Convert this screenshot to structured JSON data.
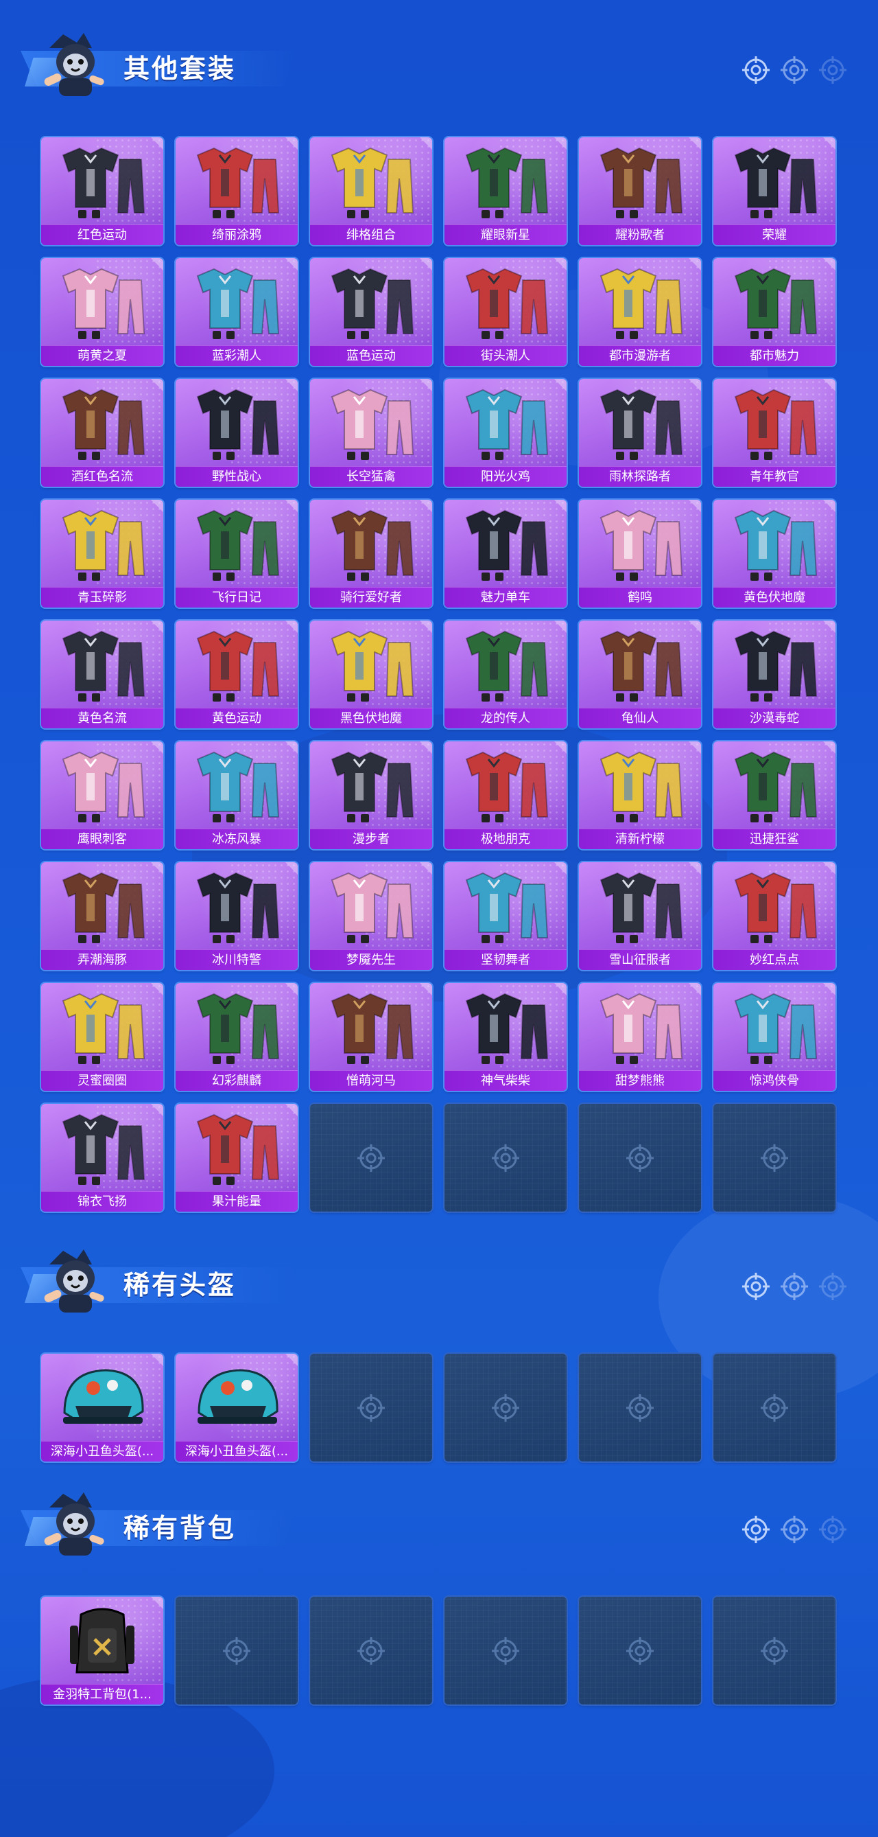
{
  "theme": {
    "card_label_bg": "#8e1fd9",
    "card_bg": "#a55fe8",
    "empty_card_bg": "#1d3d6b",
    "page_bg": "#1657d6"
  },
  "sections": [
    {
      "id": "outfits",
      "title": "其他套装",
      "items": [
        {
          "label": "红色运动",
          "art": "outfit-icon"
        },
        {
          "label": "绮丽涂鸦",
          "art": "outfit-icon"
        },
        {
          "label": "绯格组合",
          "art": "outfit-icon"
        },
        {
          "label": "耀眼新星",
          "art": "outfit-icon"
        },
        {
          "label": "耀粉歌者",
          "art": "outfit-icon"
        },
        {
          "label": "荣耀",
          "art": "outfit-icon"
        },
        {
          "label": "萌黄之夏",
          "art": "outfit-icon"
        },
        {
          "label": "蓝彩潮人",
          "art": "outfit-icon"
        },
        {
          "label": "蓝色运动",
          "art": "outfit-icon"
        },
        {
          "label": "街头潮人",
          "art": "outfit-icon"
        },
        {
          "label": "都市漫游者",
          "art": "outfit-icon"
        },
        {
          "label": "都市魅力",
          "art": "outfit-icon"
        },
        {
          "label": "酒红色名流",
          "art": "outfit-icon"
        },
        {
          "label": "野性战心",
          "art": "outfit-icon"
        },
        {
          "label": "长空猛禽",
          "art": "outfit-icon"
        },
        {
          "label": "阳光火鸡",
          "art": "outfit-icon"
        },
        {
          "label": "雨林探路者",
          "art": "outfit-icon"
        },
        {
          "label": "青年教官",
          "art": "outfit-icon"
        },
        {
          "label": "青玉碎影",
          "art": "outfit-icon"
        },
        {
          "label": "飞行日记",
          "art": "outfit-icon"
        },
        {
          "label": "骑行爱好者",
          "art": "outfit-icon"
        },
        {
          "label": "魅力单车",
          "art": "outfit-icon"
        },
        {
          "label": "鹤鸣",
          "art": "outfit-icon"
        },
        {
          "label": "黄色伏地魔",
          "art": "outfit-icon"
        },
        {
          "label": "黄色名流",
          "art": "outfit-icon"
        },
        {
          "label": "黄色运动",
          "art": "outfit-icon"
        },
        {
          "label": "黑色伏地魔",
          "art": "outfit-icon"
        },
        {
          "label": "龙的传人",
          "art": "outfit-icon"
        },
        {
          "label": "龟仙人",
          "art": "outfit-icon"
        },
        {
          "label": "沙漠毒蛇",
          "art": "outfit-icon"
        },
        {
          "label": "鹰眼刺客",
          "art": "outfit-icon"
        },
        {
          "label": "冰冻风暴",
          "art": "outfit-icon"
        },
        {
          "label": "漫步者",
          "art": "outfit-icon"
        },
        {
          "label": "极地朋克",
          "art": "outfit-icon"
        },
        {
          "label": "清新柠檬",
          "art": "outfit-icon"
        },
        {
          "label": "迅捷狂鲨",
          "art": "outfit-icon"
        },
        {
          "label": "弄潮海豚",
          "art": "outfit-icon"
        },
        {
          "label": "冰川特警",
          "art": "outfit-icon"
        },
        {
          "label": "梦魇先生",
          "art": "outfit-icon"
        },
        {
          "label": "坚韧舞者",
          "art": "outfit-icon"
        },
        {
          "label": "雪山征服者",
          "art": "outfit-icon"
        },
        {
          "label": "妙红点点",
          "art": "outfit-icon"
        },
        {
          "label": "灵蜜圈圈",
          "art": "outfit-icon"
        },
        {
          "label": "幻彩麒麟",
          "art": "outfit-icon"
        },
        {
          "label": "憎萌河马",
          "art": "outfit-icon"
        },
        {
          "label": "神气柴柴",
          "art": "outfit-icon"
        },
        {
          "label": "甜梦熊熊",
          "art": "outfit-icon"
        },
        {
          "label": "惊鸿侠骨",
          "art": "outfit-icon"
        },
        {
          "label": "锦衣飞扬",
          "art": "outfit-icon"
        },
        {
          "label": "果汁能量",
          "art": "outfit-icon"
        }
      ],
      "empty_slots": 4
    },
    {
      "id": "helmets",
      "title": "稀有头盔",
      "items": [
        {
          "label": "深海小丑鱼头盔(...",
          "art": "helmet-icon"
        },
        {
          "label": "深海小丑鱼头盔(...",
          "art": "helmet-icon"
        }
      ],
      "empty_slots": 4
    },
    {
      "id": "backpacks",
      "title": "稀有背包",
      "items": [
        {
          "label": "金羽特工背包(1...",
          "art": "backpack-icon"
        }
      ],
      "empty_slots": 5
    }
  ]
}
